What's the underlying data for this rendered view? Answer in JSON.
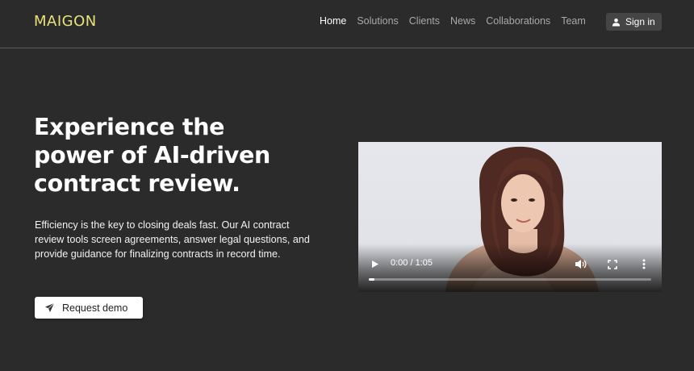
{
  "brand": {
    "name": "MAIGON"
  },
  "nav": {
    "items": [
      {
        "label": "Home",
        "active": true
      },
      {
        "label": "Solutions"
      },
      {
        "label": "Clients"
      },
      {
        "label": "News"
      },
      {
        "label": "Collaborations"
      },
      {
        "label": "Team"
      }
    ],
    "signin_label": "Sign in"
  },
  "hero": {
    "headline_lines": [
      "Experience the",
      "power of AI-driven",
      "contract review."
    ],
    "lead": "Efficiency is the key to closing deals fast. Our AI contract review tools screen agreements, answer legal questions, and provide guidance for finalizing contracts in record time.",
    "cta_label": "Request demo"
  },
  "video": {
    "time": "0:00 / 1:05",
    "progress": 0.02
  },
  "colors": {
    "background": "#2b2b2b",
    "logo": "#e8e27a",
    "nav_inactive": "#a9a9a9"
  }
}
